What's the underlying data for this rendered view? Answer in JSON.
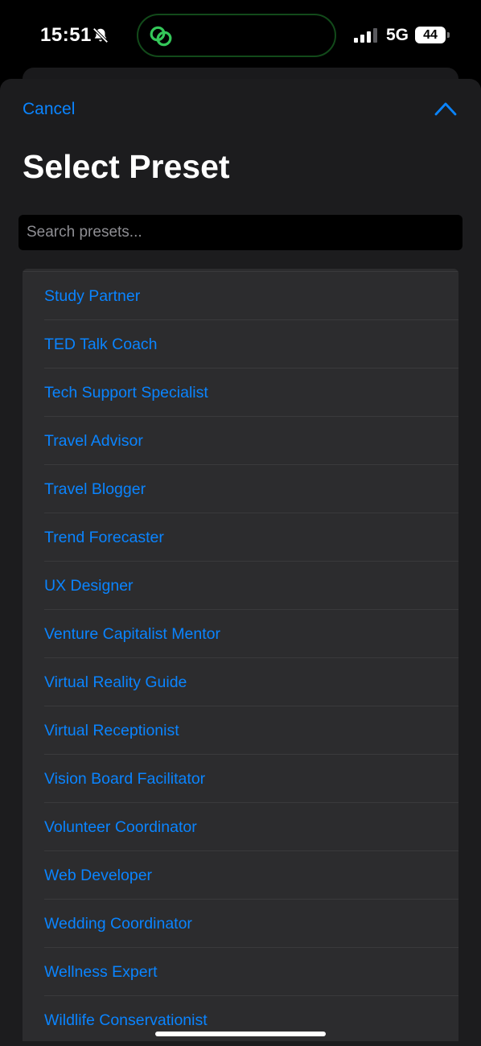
{
  "status_bar": {
    "time": "15:51",
    "network": "5G",
    "battery": "44"
  },
  "sheet": {
    "cancel_label": "Cancel",
    "title": "Select Preset",
    "search_placeholder": "Search presets..."
  },
  "presets": [
    "Study Partner",
    "TED Talk Coach",
    "Tech Support Specialist",
    "Travel Advisor",
    "Travel Blogger",
    "Trend Forecaster",
    "UX Designer",
    "Venture Capitalist Mentor",
    "Virtual Reality Guide",
    "Virtual Receptionist",
    "Vision Board Facilitator",
    "Volunteer Coordinator",
    "Web Developer",
    "Wedding Coordinator",
    "Wellness Expert",
    "Wildlife Conservationist"
  ],
  "colors": {
    "accent": "#0a84ff",
    "island_icon": "#34c759",
    "sheet_bg": "#1c1c1e",
    "list_bg": "#2c2c2e"
  },
  "icons": {
    "bell": "bell-slash-icon",
    "island": "chain-link-icon",
    "signal": "cellular-signal-icon",
    "collapse": "chevron-up-icon"
  }
}
